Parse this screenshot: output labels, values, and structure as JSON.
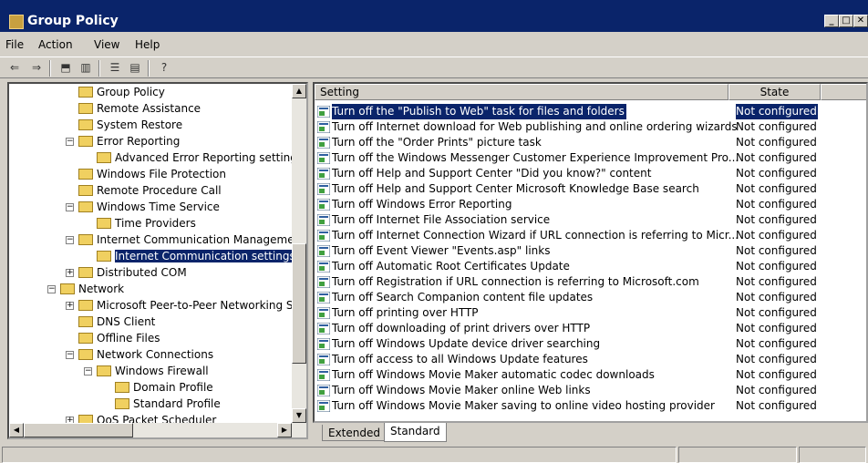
{
  "window": {
    "title": "Group Policy"
  },
  "menu": [
    "File",
    "Action",
    "View",
    "Help"
  ],
  "toolbar": {
    "buttons": [
      "back-icon",
      "forward-icon",
      "up-level-icon",
      "show-hide-tree-icon",
      "properties-icon",
      "export-list-icon",
      "help-icon"
    ]
  },
  "tree": {
    "selected": "Internet Communication settings",
    "items": [
      "Group Policy",
      "Remote Assistance",
      "System Restore",
      "Error Reporting",
      "Advanced Error Reporting settings",
      "Windows File Protection",
      "Remote Procedure Call",
      "Windows Time Service",
      "Time Providers",
      "Internet Communication Management",
      "Internet Communication settings",
      "Distributed COM",
      "Network",
      "Microsoft Peer-to-Peer Networking Se",
      "DNS Client",
      "Offline Files",
      "Network Connections",
      "Windows Firewall",
      "Domain Profile",
      "Standard Profile",
      "QoS Packet Scheduler"
    ]
  },
  "list": {
    "columns": {
      "setting": "Setting",
      "state": "State"
    },
    "rows": [
      {
        "setting": "Turn off the \"Publish to Web\" task for files and folders",
        "state": "Not configured"
      },
      {
        "setting": "Turn off Internet download for Web publishing and online ordering wizards",
        "state": "Not configured"
      },
      {
        "setting": "Turn off the \"Order Prints\" picture task",
        "state": "Not configured"
      },
      {
        "setting": "Turn off the Windows Messenger Customer Experience Improvement Pro...",
        "state": "Not configured"
      },
      {
        "setting": "Turn off Help and Support Center \"Did you know?\" content",
        "state": "Not configured"
      },
      {
        "setting": "Turn off Help and Support Center Microsoft Knowledge Base search",
        "state": "Not configured"
      },
      {
        "setting": "Turn off Windows Error Reporting",
        "state": "Not configured"
      },
      {
        "setting": "Turn off Internet File Association service",
        "state": "Not configured"
      },
      {
        "setting": "Turn off Internet Connection Wizard if URL connection is referring to Micr...",
        "state": "Not configured"
      },
      {
        "setting": "Turn off Event Viewer \"Events.asp\" links",
        "state": "Not configured"
      },
      {
        "setting": "Turn off Automatic Root Certificates Update",
        "state": "Not configured"
      },
      {
        "setting": "Turn off Registration if URL connection is referring to Microsoft.com",
        "state": "Not configured"
      },
      {
        "setting": "Turn off Search Companion content file updates",
        "state": "Not configured"
      },
      {
        "setting": "Turn off printing over HTTP",
        "state": "Not configured"
      },
      {
        "setting": "Turn off downloading of print drivers over HTTP",
        "state": "Not configured"
      },
      {
        "setting": "Turn off Windows Update device driver searching",
        "state": "Not configured"
      },
      {
        "setting": "Turn off access to all Windows Update features",
        "state": "Not configured"
      },
      {
        "setting": "Turn off Windows Movie Maker automatic codec downloads",
        "state": "Not configured"
      },
      {
        "setting": "Turn off Windows Movie Maker online Web links",
        "state": "Not configured"
      },
      {
        "setting": "Turn off Windows Movie Maker saving to online video hosting provider",
        "state": "Not configured"
      }
    ]
  },
  "tabs": [
    "Extended",
    "Standard"
  ],
  "active_tab": "Standard",
  "colors": {
    "titlebar": "#0a246a",
    "selection": "#0a246a",
    "face": "#d4d0c8"
  }
}
